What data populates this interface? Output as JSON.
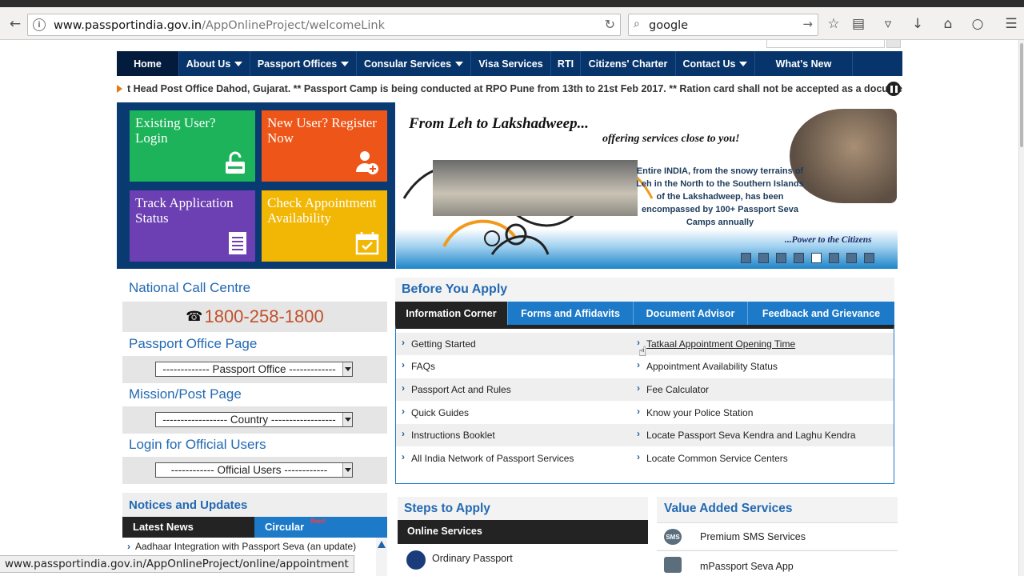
{
  "browser": {
    "url_host": "www.passportindia.gov.in",
    "url_path": "/AppOnlineProject/welcomeLink",
    "search_query": "google",
    "status_url": "www.passportindia.gov.in/AppOnlineProject/online/appointment"
  },
  "nav": {
    "items": [
      "Home",
      "About Us",
      "Passport Offices",
      "Consular Services",
      "Visa Services",
      "RTI",
      "Citizens' Charter",
      "Contact Us",
      "What's New"
    ]
  },
  "ticker": {
    "text": "t Head Post Office Dahod, Gujarat. ** Passport Camp is being conducted at RPO Pune from 13th to 21st Feb 2017. ** Ration card shall not be accepted as a document of"
  },
  "tiles": {
    "existing": "Existing User? Login",
    "register": "New User? Register Now",
    "track": "Track Application Status",
    "check": "Check Appointment Availability"
  },
  "banner": {
    "headline": "From Leh to Lakshadweep...",
    "tagline": "offering services close to you!",
    "blurb": "Entire INDIA, from the snowy terrains of Leh in the North to the Southern Islands of the Lakshadweep, has been encompassed by 100+ Passport Seva Camps annually",
    "power": "...Power to the Citizens"
  },
  "left": {
    "call_title": "National Call Centre",
    "phone": "1800-258-1800",
    "office_title": "Passport Office Page",
    "office_select": "------------- Passport Office -------------",
    "mission_title": "Mission/Post Page",
    "mission_select": "------------------ Country ------------------",
    "login_title": "Login for Official Users",
    "login_select": "------------ Official Users ------------"
  },
  "notices": {
    "title": "Notices and Updates",
    "tab_latest": "Latest News",
    "tab_circular": "Circular",
    "new_badge": "New!",
    "item": "Aadhaar Integration with Passport Seva (an update)"
  },
  "before_apply": {
    "title": "Before You Apply",
    "tabs": [
      "Information Corner",
      "Forms and Affidavits",
      "Document Advisor",
      "Feedback and Grievance"
    ],
    "left_links": [
      "Getting Started",
      "FAQs",
      "Passport Act and Rules",
      "Quick Guides",
      "Instructions Booklet",
      "All India Network of Passport Services"
    ],
    "right_links": [
      "Tatkaal Appointment Opening Time",
      "Appointment Availability Status",
      "Fee Calculator",
      "Know your Police Station",
      "Locate Passport Seva Kendra and Laghu Kendra",
      "Locate Common Service Centers"
    ]
  },
  "steps": {
    "title": "Steps to Apply",
    "bar": "Online Services",
    "item": "Ordinary Passport"
  },
  "vas": {
    "title": "Value Added Services",
    "sms": "Premium SMS Services",
    "sms_icon": "SMS",
    "app": "mPassport Seva App"
  }
}
